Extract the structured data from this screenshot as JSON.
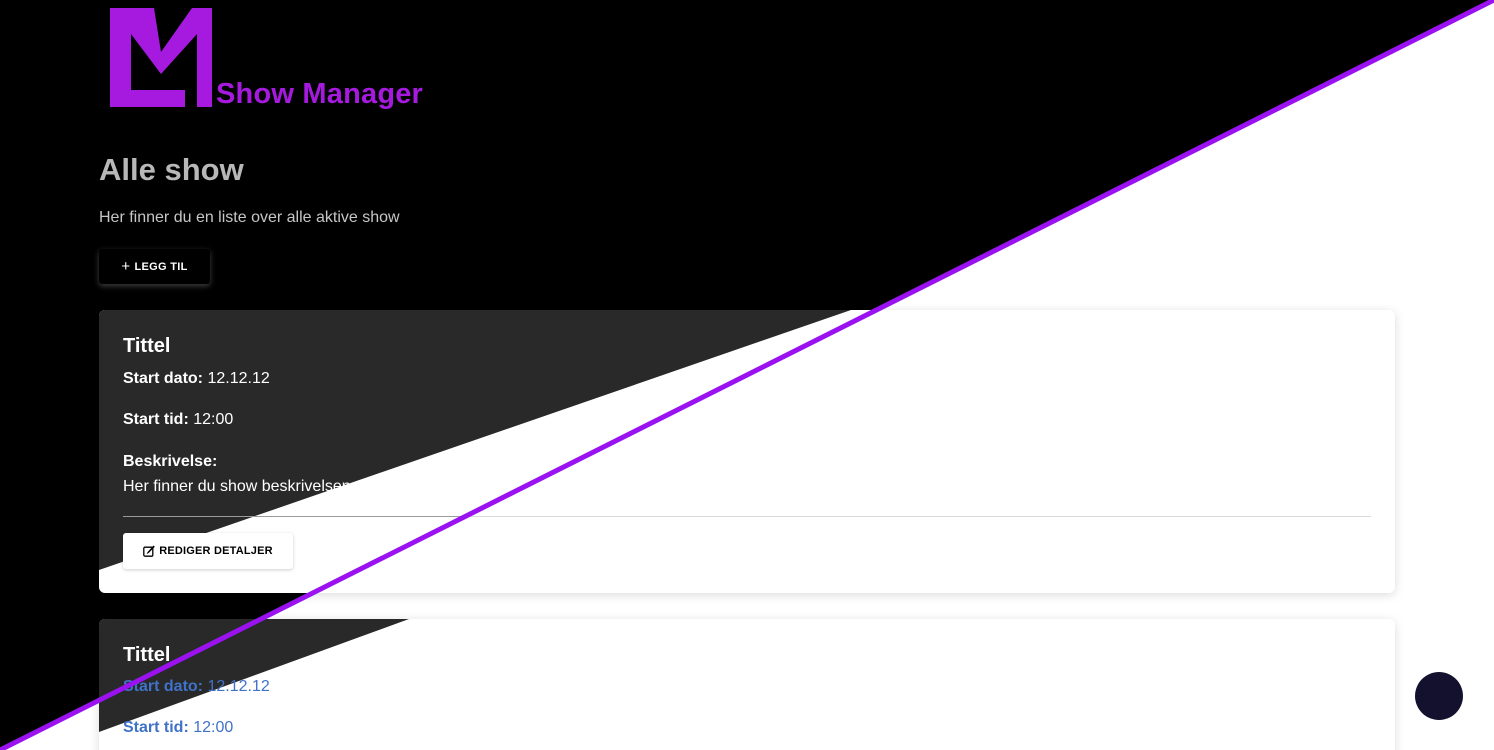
{
  "app": {
    "logo_text": "Show Manager",
    "logo_color": "#a61ae0"
  },
  "page": {
    "title": "Alle show",
    "subtitle": "Her finner du en liste over alle aktive show"
  },
  "toolbar": {
    "add_label": "LEGG TIL",
    "add_icon": "plus-icon"
  },
  "shows": [
    {
      "title": "Tittel",
      "start_date_label": "Start dato:",
      "start_date": "12.12.12",
      "start_time_label": "Start tid:",
      "start_time": "12:00",
      "description_label": "Beskrivelse:",
      "description": "Her finner du show beskrivelsen",
      "edit_label": "REDIGER DETALJER",
      "edit_icon": "edit-icon"
    },
    {
      "title": "Tittel",
      "start_date_label": "Start dato:",
      "start_date": "12.12.12",
      "start_time_label": "Start tid:",
      "start_time": "12:00"
    }
  ],
  "colors": {
    "accent_line": "#9b12f0",
    "fab": "#14112e",
    "link_blue": "#3f72c9"
  }
}
